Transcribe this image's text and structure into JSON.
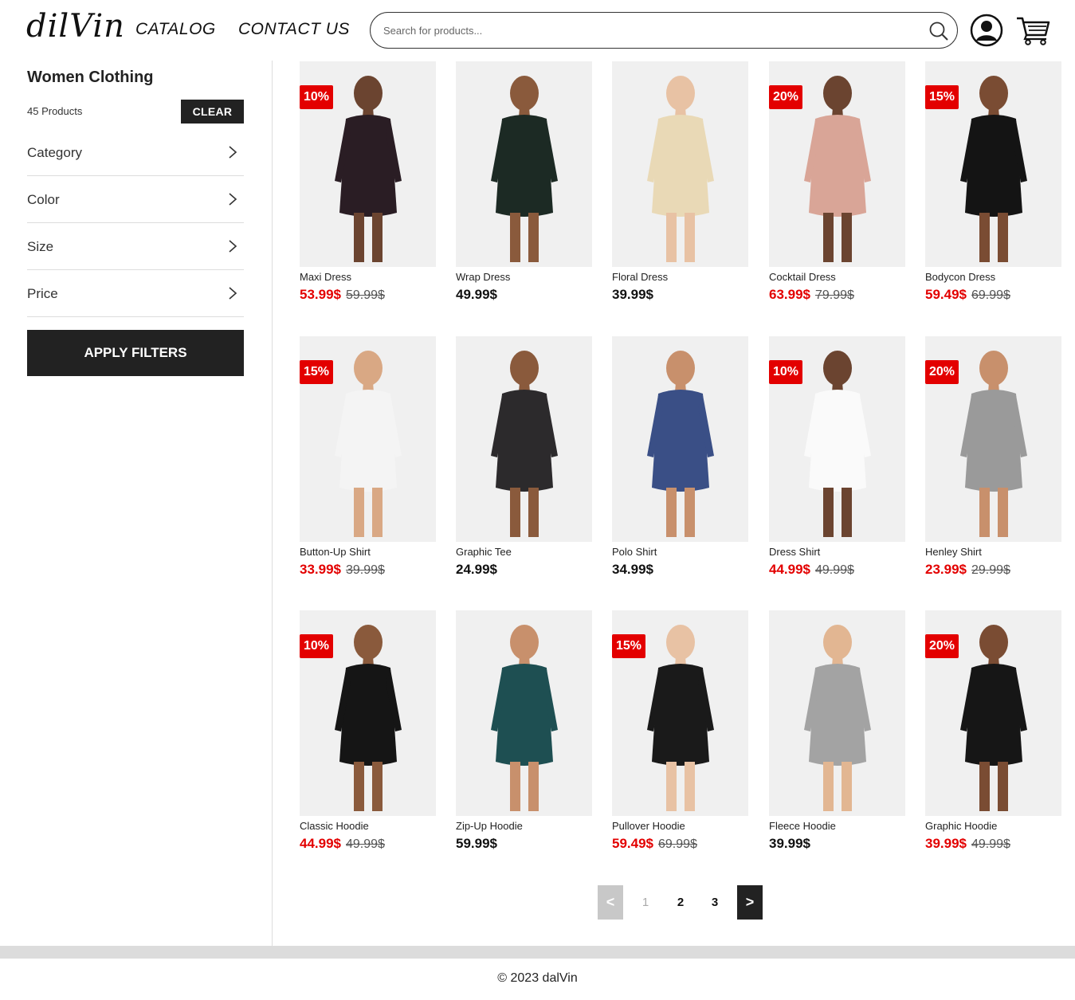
{
  "header": {
    "logo": "dilVin",
    "nav": {
      "catalog": "CATALOG",
      "contact": "CONTACT US"
    },
    "search": {
      "placeholder": "Search for products...",
      "value": ""
    }
  },
  "sidebar": {
    "title": "Women Clothing",
    "count": "45 Products",
    "clear_label": "CLEAR",
    "filters": [
      "Category",
      "Color",
      "Size",
      "Price"
    ],
    "apply_label": "APPLY FILTERS"
  },
  "products": [
    {
      "name": "Maxi Dress",
      "price": "53.99$",
      "old_price": "59.99$",
      "badge": "10%",
      "garment": "#2a1d24",
      "skin": "#6b4430"
    },
    {
      "name": "Wrap Dress",
      "price": "49.99$",
      "old_price": "",
      "badge": "",
      "garment": "#1c2a24",
      "skin": "#8a5a3c"
    },
    {
      "name": "Floral Dress",
      "price": "39.99$",
      "old_price": "",
      "badge": "",
      "garment": "#e9d9b6",
      "skin": "#e8c2a4"
    },
    {
      "name": "Cocktail Dress",
      "price": "63.99$",
      "old_price": "79.99$",
      "badge": "20%",
      "garment": "#d9a597",
      "skin": "#6b4430"
    },
    {
      "name": "Bodycon Dress",
      "price": "59.49$",
      "old_price": "69.99$",
      "badge": "15%",
      "garment": "#141414",
      "skin": "#7a4c33"
    },
    {
      "name": "Button-Up Shirt",
      "price": "33.99$",
      "old_price": "39.99$",
      "badge": "15%",
      "garment": "#f4f4f4",
      "skin": "#d9a884"
    },
    {
      "name": "Graphic Tee",
      "price": "24.99$",
      "old_price": "",
      "badge": "",
      "garment": "#2c2a2c",
      "skin": "#8a5a3c"
    },
    {
      "name": "Polo Shirt",
      "price": "34.99$",
      "old_price": "",
      "badge": "",
      "garment": "#3a4f86",
      "skin": "#c8906c"
    },
    {
      "name": "Dress Shirt",
      "price": "44.99$",
      "old_price": "49.99$",
      "badge": "10%",
      "garment": "#fafafa",
      "skin": "#6b4430"
    },
    {
      "name": "Henley Shirt",
      "price": "23.99$",
      "old_price": "29.99$",
      "badge": "20%",
      "garment": "#9a9a9a",
      "skin": "#c8906c"
    },
    {
      "name": "Classic Hoodie",
      "price": "44.99$",
      "old_price": "49.99$",
      "badge": "10%",
      "garment": "#151515",
      "skin": "#8a5a3c"
    },
    {
      "name": "Zip-Up Hoodie",
      "price": "59.99$",
      "old_price": "",
      "badge": "",
      "garment": "#1e4f52",
      "skin": "#c8906c"
    },
    {
      "name": "Pullover Hoodie",
      "price": "59.49$",
      "old_price": "69.99$",
      "badge": "15%",
      "garment": "#1a1a1a",
      "skin": "#e8c2a4"
    },
    {
      "name": "Fleece Hoodie",
      "price": "39.99$",
      "old_price": "",
      "badge": "",
      "garment": "#a3a3a3",
      "skin": "#e2b692"
    },
    {
      "name": "Graphic Hoodie",
      "price": "39.99$",
      "old_price": "49.99$",
      "badge": "20%",
      "garment": "#161616",
      "skin": "#7a4c33"
    }
  ],
  "pagination": {
    "prev": "<",
    "pages": [
      "1",
      "2",
      "3"
    ],
    "next": ">",
    "current": "1"
  },
  "footer": {
    "copyright": "© 2023 dalVin"
  },
  "colors": {
    "sale": "#e30000",
    "dark": "#222222",
    "border": "#dddddd"
  }
}
